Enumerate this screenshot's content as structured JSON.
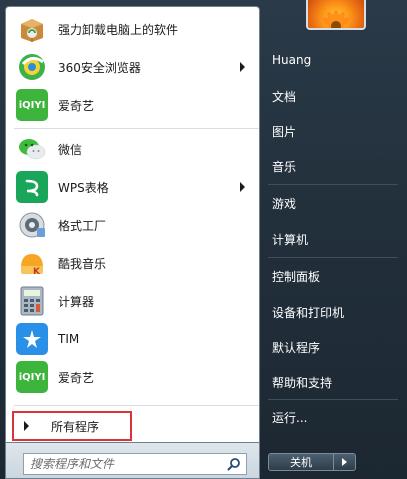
{
  "programs": [
    {
      "label": "强力卸载电脑上的软件",
      "icon": "uninstall-box-icon",
      "has_submenu": false
    },
    {
      "label": "360安全浏览器",
      "icon": "360-browser-icon",
      "has_submenu": true
    },
    {
      "label": "爱奇艺",
      "icon": "iqiyi-icon",
      "has_submenu": false
    },
    {
      "label": "微信",
      "icon": "wechat-icon",
      "has_submenu": false
    },
    {
      "label": "WPS表格",
      "icon": "wps-spreadsheet-icon",
      "has_submenu": true
    },
    {
      "label": "格式工厂",
      "icon": "format-factory-icon",
      "has_submenu": false
    },
    {
      "label": "酷我音乐",
      "icon": "kuwo-music-icon",
      "has_submenu": false
    },
    {
      "label": "计算器",
      "icon": "calculator-icon",
      "has_submenu": false
    },
    {
      "label": "TIM",
      "icon": "tim-icon",
      "has_submenu": false
    },
    {
      "label": "爱奇艺",
      "icon": "iqiyi-icon",
      "has_submenu": false
    }
  ],
  "all_programs": {
    "label": "所有程序"
  },
  "search": {
    "placeholder": "搜索程序和文件"
  },
  "right_menu": {
    "user": "Huang",
    "items": [
      "文档",
      "图片",
      "音乐",
      "游戏",
      "计算机",
      "控制面板",
      "设备和打印机",
      "默认程序",
      "帮助和支持",
      "运行..."
    ]
  },
  "shutdown": {
    "label": "关机"
  },
  "colors": {
    "highlight_border": "#d9343a",
    "panel_dark": "#23313d"
  }
}
